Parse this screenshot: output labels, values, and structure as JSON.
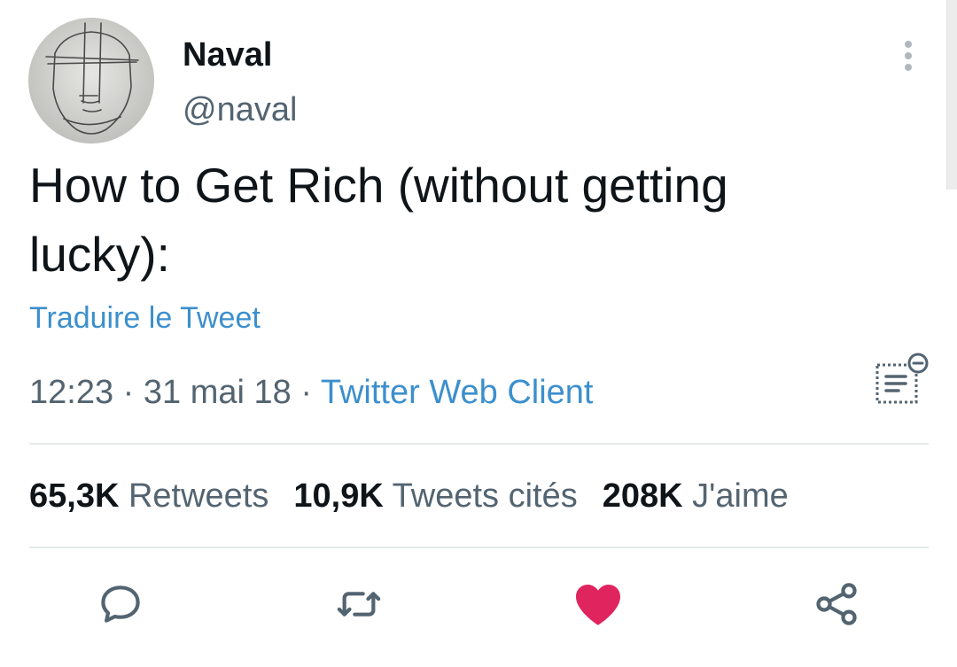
{
  "author": {
    "name": "Naval",
    "handle": "@naval"
  },
  "tweet": {
    "text": "How to Get Rich (without getting lucky):",
    "translate_label": "Traduire le Tweet",
    "time": "12:23",
    "separator": " · ",
    "date": "31 mai 18",
    "client": "Twitter Web Client"
  },
  "stats": [
    {
      "count": "65,3K",
      "label": "Retweets"
    },
    {
      "count": "10,9K",
      "label": "Tweets cités"
    },
    {
      "count": "208K",
      "label": "J'aime"
    }
  ],
  "actions": {
    "reply": "reply-icon",
    "retweet": "retweet-icon",
    "like": "heart-icon",
    "share": "share-icon"
  },
  "colors": {
    "link": "#3c8fcd",
    "secondary_text": "#536471",
    "like_active": "#e0245e",
    "icon": "#536471"
  }
}
